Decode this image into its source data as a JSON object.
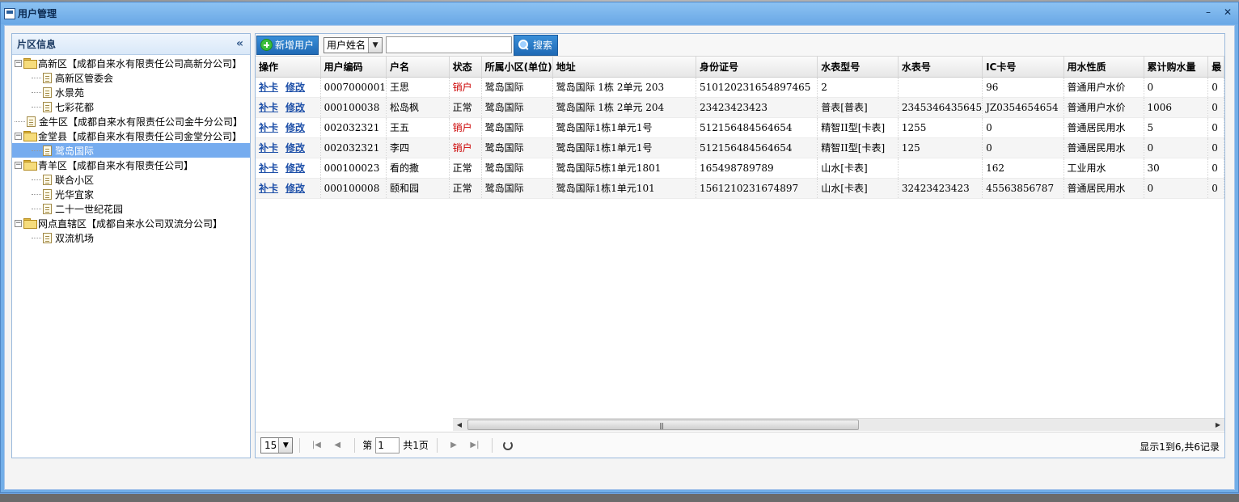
{
  "window": {
    "title": "用户管理",
    "minimize_label": "–",
    "close_label": "✕"
  },
  "left_panel": {
    "title": "片区信息",
    "collapse_label": "«",
    "tree": [
      {
        "label": "高新区【成都自来水有限责任公司高新分公司】",
        "type": "folder",
        "level": 0,
        "expanded": true
      },
      {
        "label": "高新区管委会",
        "type": "leaf",
        "level": 1
      },
      {
        "label": "水景苑",
        "type": "leaf",
        "level": 1
      },
      {
        "label": "七彩花都",
        "type": "leaf",
        "level": 1
      },
      {
        "label": "金牛区【成都自来水有限责任公司金牛分公司】",
        "type": "leafroot",
        "level": 0
      },
      {
        "label": "金堂县【成都自来水有限责任公司金堂分公司】",
        "type": "folder",
        "level": 0,
        "expanded": true
      },
      {
        "label": "鹭岛国际",
        "type": "leaf",
        "level": 1,
        "selected": true
      },
      {
        "label": "青羊区【成都自来水有限责任公司】",
        "type": "folder",
        "level": 0,
        "expanded": true
      },
      {
        "label": "联合小区",
        "type": "leaf",
        "level": 1
      },
      {
        "label": "光华宜家",
        "type": "leaf",
        "level": 1
      },
      {
        "label": "二十一世纪花园",
        "type": "leaf",
        "level": 1
      },
      {
        "label": "网点直辖区【成都自来水公司双流分公司】",
        "type": "folder",
        "level": 0,
        "expanded": true
      },
      {
        "label": "双流机场",
        "type": "leaf",
        "level": 1
      }
    ]
  },
  "toolbar": {
    "add_label": "新增用户",
    "search_field": "用户姓名",
    "search_value": "",
    "search_label": "搜索"
  },
  "table": {
    "columns": [
      "操作",
      "用户编码",
      "户名",
      "状态",
      "所属小区(单位)",
      "地址",
      "身份证号",
      "水表型号",
      "水表号",
      "IC卡号",
      "用水性质",
      "累计购水量",
      "最"
    ],
    "action_labels": {
      "reissue": "补卡",
      "edit": "修改"
    },
    "rows": [
      {
        "code": "0007000001",
        "name": "王思",
        "status": "销户",
        "status_color": "#cc0000",
        "community": "鹭岛国际",
        "address": "鹭岛国际 1栋 2单元 203",
        "id_no": "510120231654897465",
        "meter_model": "2",
        "meter_no": "",
        "ic_card": "96",
        "usage_type": "普通用户水价",
        "total_water": "0",
        "last": "0"
      },
      {
        "code": "000100038",
        "name": "松岛枫",
        "status": "正常",
        "status_color": "#000000",
        "community": "鹭岛国际",
        "address": "鹭岛国际 1栋 2单元 204",
        "id_no": "23423423423",
        "meter_model": "普表[普表]",
        "meter_no": "2345346435645",
        "ic_card": "JZ0354654654",
        "usage_type": "普通用户水价",
        "total_water": "1006",
        "last": "0"
      },
      {
        "code": "002032321",
        "name": "王五",
        "status": "销户",
        "status_color": "#cc0000",
        "community": "鹭岛国际",
        "address": "鹭岛国际1栋1单元1号",
        "id_no": "512156484564654",
        "meter_model": "精智II型[卡表]",
        "meter_no": "1255",
        "ic_card": "0",
        "usage_type": "普通居民用水",
        "total_water": "5",
        "last": "0"
      },
      {
        "code": "002032321",
        "name": "李四",
        "status": "销户",
        "status_color": "#cc0000",
        "community": "鹭岛国际",
        "address": "鹭岛国际1栋1单元1号",
        "id_no": "512156484564654",
        "meter_model": "精智II型[卡表]",
        "meter_no": "125",
        "ic_card": "0",
        "usage_type": "普通居民用水",
        "total_water": "0",
        "last": "0"
      },
      {
        "code": "000100023",
        "name": "看的撒",
        "status": "正常",
        "status_color": "#000000",
        "community": "鹭岛国际",
        "address": "鹭岛国际5栋1单元1801",
        "id_no": "165498789789",
        "meter_model": "山水[卡表]",
        "meter_no": "",
        "ic_card": "162",
        "usage_type": "工业用水",
        "total_water": "30",
        "last": "0"
      },
      {
        "code": "000100008",
        "name": "颐和园",
        "status": "正常",
        "status_color": "#000000",
        "community": "鹭岛国际",
        "address": "鹭岛国际1栋1单元101",
        "id_no": "1561210231674897",
        "meter_model": "山水[卡表]",
        "meter_no": "32423423423",
        "ic_card": "45563856787",
        "usage_type": "普通居民用水",
        "total_water": "0",
        "last": "0"
      }
    ]
  },
  "pager": {
    "page_size": "15",
    "page_prefix": "第",
    "page_value": "1",
    "page_total": "共1页",
    "info": "显示1到6,共6记录"
  },
  "colors": {
    "title_bg": "#72aee8",
    "selected_node": "#76acef",
    "status_closed": "#cc0000",
    "button_bg": "#1f69b5"
  }
}
